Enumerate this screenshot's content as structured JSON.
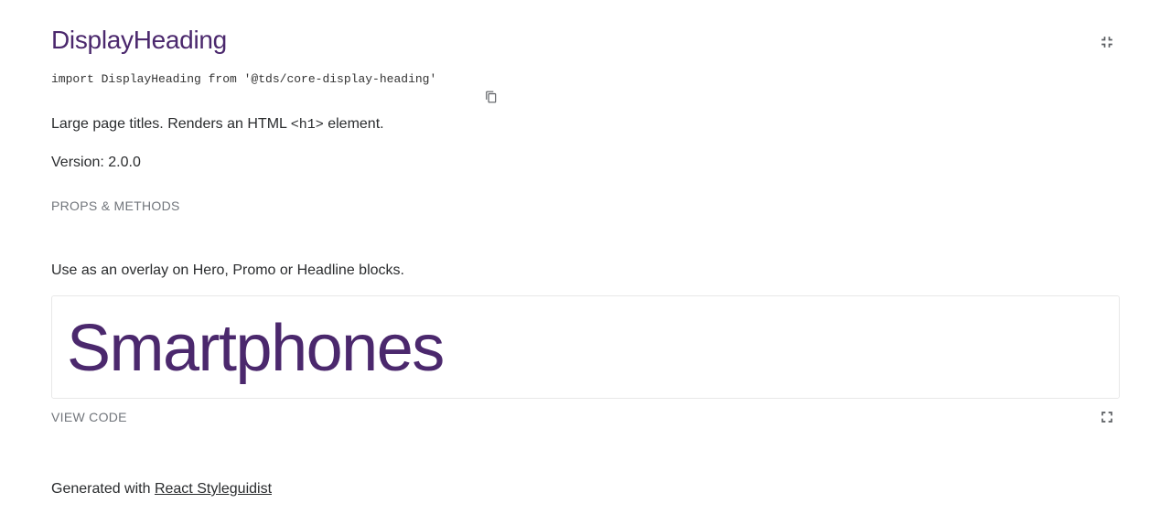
{
  "component": {
    "title": "DisplayHeading",
    "import_statement": "import DisplayHeading from '@tds/core-display-heading'",
    "description_prefix": "Large page titles. Renders an HTML ",
    "description_code": "<h1>",
    "description_suffix": " element.",
    "version": "Version: 2.0.0",
    "props_link": "PROPS & METHODS"
  },
  "example": {
    "usage_text": "Use as an overlay on Hero, Promo or Headline blocks.",
    "preview_heading": "Smartphones",
    "view_code_label": "VIEW CODE"
  },
  "footer": {
    "prefix": "Generated with ",
    "link_text": "React Styleguidist"
  },
  "icons": {
    "collapse": "collapse-icon",
    "copy": "copy-icon",
    "expand": "fullscreen-icon"
  },
  "colors": {
    "brand_purple": "#4b286d",
    "text": "#2a2c2e",
    "muted": "#71757b",
    "border": "#e8e8e8"
  }
}
